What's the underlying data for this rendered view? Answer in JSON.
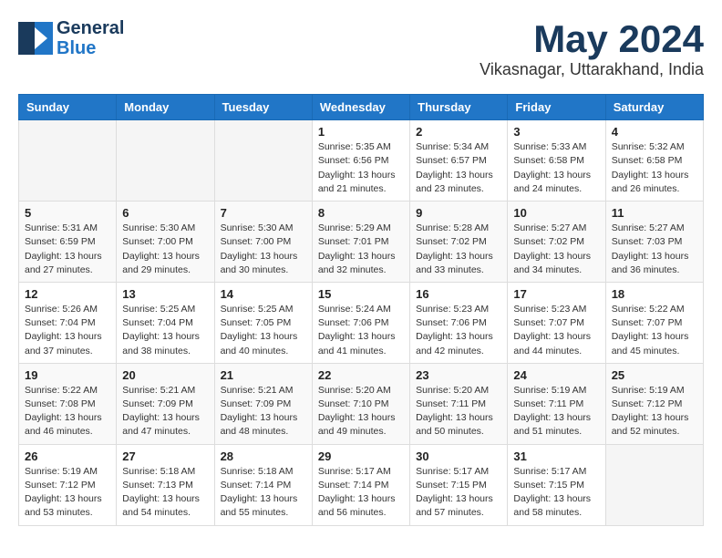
{
  "logo": {
    "text_general": "General",
    "text_blue": "Blue"
  },
  "title": {
    "month_year": "May 2024",
    "location": "Vikasnagar, Uttarakhand, India"
  },
  "weekdays": [
    "Sunday",
    "Monday",
    "Tuesday",
    "Wednesday",
    "Thursday",
    "Friday",
    "Saturday"
  ],
  "weeks": [
    [
      {
        "day": "",
        "sunrise": "",
        "sunset": "",
        "daylight": ""
      },
      {
        "day": "",
        "sunrise": "",
        "sunset": "",
        "daylight": ""
      },
      {
        "day": "",
        "sunrise": "",
        "sunset": "",
        "daylight": ""
      },
      {
        "day": "1",
        "sunrise": "Sunrise: 5:35 AM",
        "sunset": "Sunset: 6:56 PM",
        "daylight": "Daylight: 13 hours and 21 minutes."
      },
      {
        "day": "2",
        "sunrise": "Sunrise: 5:34 AM",
        "sunset": "Sunset: 6:57 PM",
        "daylight": "Daylight: 13 hours and 23 minutes."
      },
      {
        "day": "3",
        "sunrise": "Sunrise: 5:33 AM",
        "sunset": "Sunset: 6:58 PM",
        "daylight": "Daylight: 13 hours and 24 minutes."
      },
      {
        "day": "4",
        "sunrise": "Sunrise: 5:32 AM",
        "sunset": "Sunset: 6:58 PM",
        "daylight": "Daylight: 13 hours and 26 minutes."
      }
    ],
    [
      {
        "day": "5",
        "sunrise": "Sunrise: 5:31 AM",
        "sunset": "Sunset: 6:59 PM",
        "daylight": "Daylight: 13 hours and 27 minutes."
      },
      {
        "day": "6",
        "sunrise": "Sunrise: 5:30 AM",
        "sunset": "Sunset: 7:00 PM",
        "daylight": "Daylight: 13 hours and 29 minutes."
      },
      {
        "day": "7",
        "sunrise": "Sunrise: 5:30 AM",
        "sunset": "Sunset: 7:00 PM",
        "daylight": "Daylight: 13 hours and 30 minutes."
      },
      {
        "day": "8",
        "sunrise": "Sunrise: 5:29 AM",
        "sunset": "Sunset: 7:01 PM",
        "daylight": "Daylight: 13 hours and 32 minutes."
      },
      {
        "day": "9",
        "sunrise": "Sunrise: 5:28 AM",
        "sunset": "Sunset: 7:02 PM",
        "daylight": "Daylight: 13 hours and 33 minutes."
      },
      {
        "day": "10",
        "sunrise": "Sunrise: 5:27 AM",
        "sunset": "Sunset: 7:02 PM",
        "daylight": "Daylight: 13 hours and 34 minutes."
      },
      {
        "day": "11",
        "sunrise": "Sunrise: 5:27 AM",
        "sunset": "Sunset: 7:03 PM",
        "daylight": "Daylight: 13 hours and 36 minutes."
      }
    ],
    [
      {
        "day": "12",
        "sunrise": "Sunrise: 5:26 AM",
        "sunset": "Sunset: 7:04 PM",
        "daylight": "Daylight: 13 hours and 37 minutes."
      },
      {
        "day": "13",
        "sunrise": "Sunrise: 5:25 AM",
        "sunset": "Sunset: 7:04 PM",
        "daylight": "Daylight: 13 hours and 38 minutes."
      },
      {
        "day": "14",
        "sunrise": "Sunrise: 5:25 AM",
        "sunset": "Sunset: 7:05 PM",
        "daylight": "Daylight: 13 hours and 40 minutes."
      },
      {
        "day": "15",
        "sunrise": "Sunrise: 5:24 AM",
        "sunset": "Sunset: 7:06 PM",
        "daylight": "Daylight: 13 hours and 41 minutes."
      },
      {
        "day": "16",
        "sunrise": "Sunrise: 5:23 AM",
        "sunset": "Sunset: 7:06 PM",
        "daylight": "Daylight: 13 hours and 42 minutes."
      },
      {
        "day": "17",
        "sunrise": "Sunrise: 5:23 AM",
        "sunset": "Sunset: 7:07 PM",
        "daylight": "Daylight: 13 hours and 44 minutes."
      },
      {
        "day": "18",
        "sunrise": "Sunrise: 5:22 AM",
        "sunset": "Sunset: 7:07 PM",
        "daylight": "Daylight: 13 hours and 45 minutes."
      }
    ],
    [
      {
        "day": "19",
        "sunrise": "Sunrise: 5:22 AM",
        "sunset": "Sunset: 7:08 PM",
        "daylight": "Daylight: 13 hours and 46 minutes."
      },
      {
        "day": "20",
        "sunrise": "Sunrise: 5:21 AM",
        "sunset": "Sunset: 7:09 PM",
        "daylight": "Daylight: 13 hours and 47 minutes."
      },
      {
        "day": "21",
        "sunrise": "Sunrise: 5:21 AM",
        "sunset": "Sunset: 7:09 PM",
        "daylight": "Daylight: 13 hours and 48 minutes."
      },
      {
        "day": "22",
        "sunrise": "Sunrise: 5:20 AM",
        "sunset": "Sunset: 7:10 PM",
        "daylight": "Daylight: 13 hours and 49 minutes."
      },
      {
        "day": "23",
        "sunrise": "Sunrise: 5:20 AM",
        "sunset": "Sunset: 7:11 PM",
        "daylight": "Daylight: 13 hours and 50 minutes."
      },
      {
        "day": "24",
        "sunrise": "Sunrise: 5:19 AM",
        "sunset": "Sunset: 7:11 PM",
        "daylight": "Daylight: 13 hours and 51 minutes."
      },
      {
        "day": "25",
        "sunrise": "Sunrise: 5:19 AM",
        "sunset": "Sunset: 7:12 PM",
        "daylight": "Daylight: 13 hours and 52 minutes."
      }
    ],
    [
      {
        "day": "26",
        "sunrise": "Sunrise: 5:19 AM",
        "sunset": "Sunset: 7:12 PM",
        "daylight": "Daylight: 13 hours and 53 minutes."
      },
      {
        "day": "27",
        "sunrise": "Sunrise: 5:18 AM",
        "sunset": "Sunset: 7:13 PM",
        "daylight": "Daylight: 13 hours and 54 minutes."
      },
      {
        "day": "28",
        "sunrise": "Sunrise: 5:18 AM",
        "sunset": "Sunset: 7:14 PM",
        "daylight": "Daylight: 13 hours and 55 minutes."
      },
      {
        "day": "29",
        "sunrise": "Sunrise: 5:17 AM",
        "sunset": "Sunset: 7:14 PM",
        "daylight": "Daylight: 13 hours and 56 minutes."
      },
      {
        "day": "30",
        "sunrise": "Sunrise: 5:17 AM",
        "sunset": "Sunset: 7:15 PM",
        "daylight": "Daylight: 13 hours and 57 minutes."
      },
      {
        "day": "31",
        "sunrise": "Sunrise: 5:17 AM",
        "sunset": "Sunset: 7:15 PM",
        "daylight": "Daylight: 13 hours and 58 minutes."
      },
      {
        "day": "",
        "sunrise": "",
        "sunset": "",
        "daylight": ""
      }
    ]
  ]
}
